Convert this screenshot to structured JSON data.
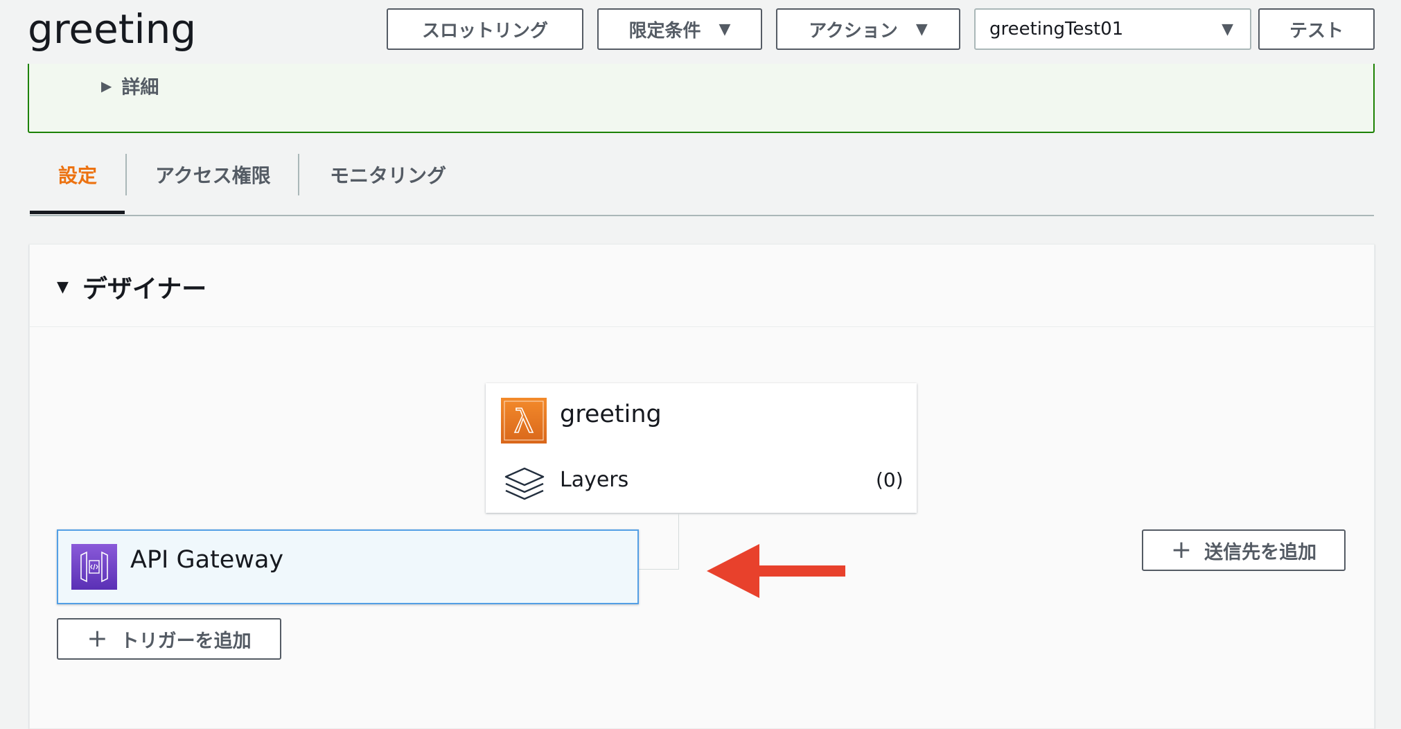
{
  "header": {
    "title": "greeting",
    "throttling_label": "スロットリング",
    "qualifiers_label": "限定条件",
    "actions_label": "アクション",
    "test_event_value": "greetingTest01",
    "test_label": "テスト"
  },
  "details": {
    "label": "詳細"
  },
  "tabs": [
    {
      "label": "設定",
      "active": true
    },
    {
      "label": "アクセス権限",
      "active": false
    },
    {
      "label": "モニタリング",
      "active": false
    }
  ],
  "designer": {
    "title": "デザイナー",
    "function_name": "greeting",
    "layers_label": "Layers",
    "layers_count": "(0)",
    "trigger_name": "API Gateway",
    "add_trigger_label": "トリガーを追加",
    "add_destination_label": "送信先を追加"
  },
  "colors": {
    "accent_tab": "#ec7211",
    "lambda_icon": "#e7762b",
    "api_gateway_icon": "#7a49cc",
    "annotation_arrow": "#e8412c",
    "details_border": "#1d8102"
  }
}
